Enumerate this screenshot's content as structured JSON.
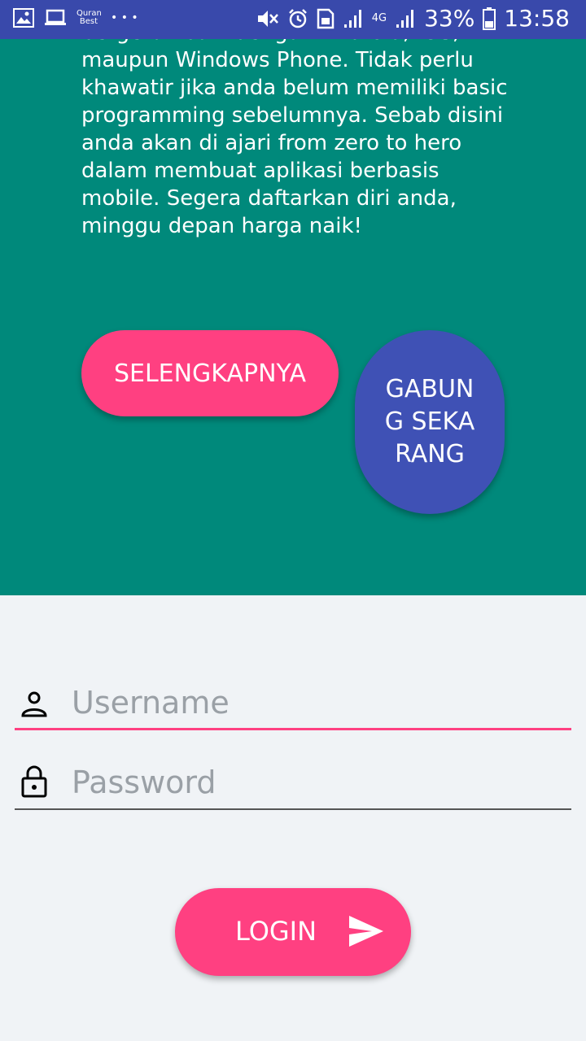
{
  "status_bar": {
    "notification_app": "Quran Best",
    "more_indicator": "• • •",
    "network_type": "4G",
    "battery_percent": "33%",
    "time": "13:58"
  },
  "hero": {
    "description": "bergerak baik dengan Android, IOS, maupun Windows Phone. Tidak perlu khawatir jika anda belum memiliki basic programming sebelumnya. Sebab disini anda akan di ajari from zero to hero dalam membuat aplikasi berbasis mobile. Segera daftarkan diri anda, minggu depan harga naik!",
    "more_button": "SELENGKAPNYA",
    "join_button": "GABUNG SEKARANG"
  },
  "login_form": {
    "username_placeholder": "Username",
    "password_placeholder": "Password",
    "login_button": "LOGIN"
  },
  "colors": {
    "status_bar": "#3949AB",
    "hero_bg": "#00897B",
    "accent": "#FF4081",
    "join_button": "#3F51B5",
    "form_bg": "#F0F3F6"
  }
}
